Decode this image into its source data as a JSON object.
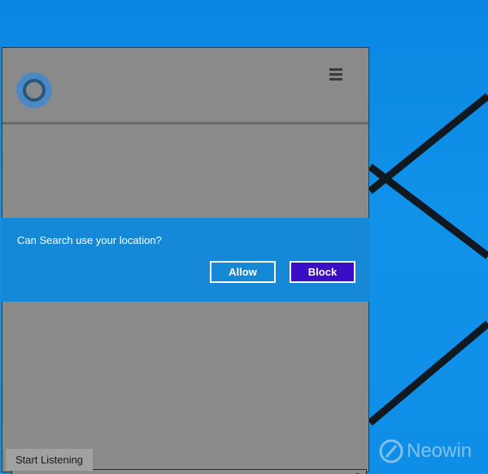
{
  "desktop": {
    "watermark_text": "Neowin"
  },
  "panel": {
    "menu_icon": "hamburger-menu-icon",
    "assistant_icon": "cortana-ring-icon"
  },
  "location_prompt": {
    "question": "Can Search use your location?",
    "allow_label": "Allow",
    "block_label": "Block"
  },
  "search": {
    "value": "",
    "icon": "search-icon"
  },
  "listen": {
    "label": "Start Listening"
  },
  "colors": {
    "desktop_bg": "#0f8ee7",
    "panel_bg": "#8a8a8a",
    "banner_bg": "#1689d6",
    "block_button_bg": "#3a0ec4"
  }
}
